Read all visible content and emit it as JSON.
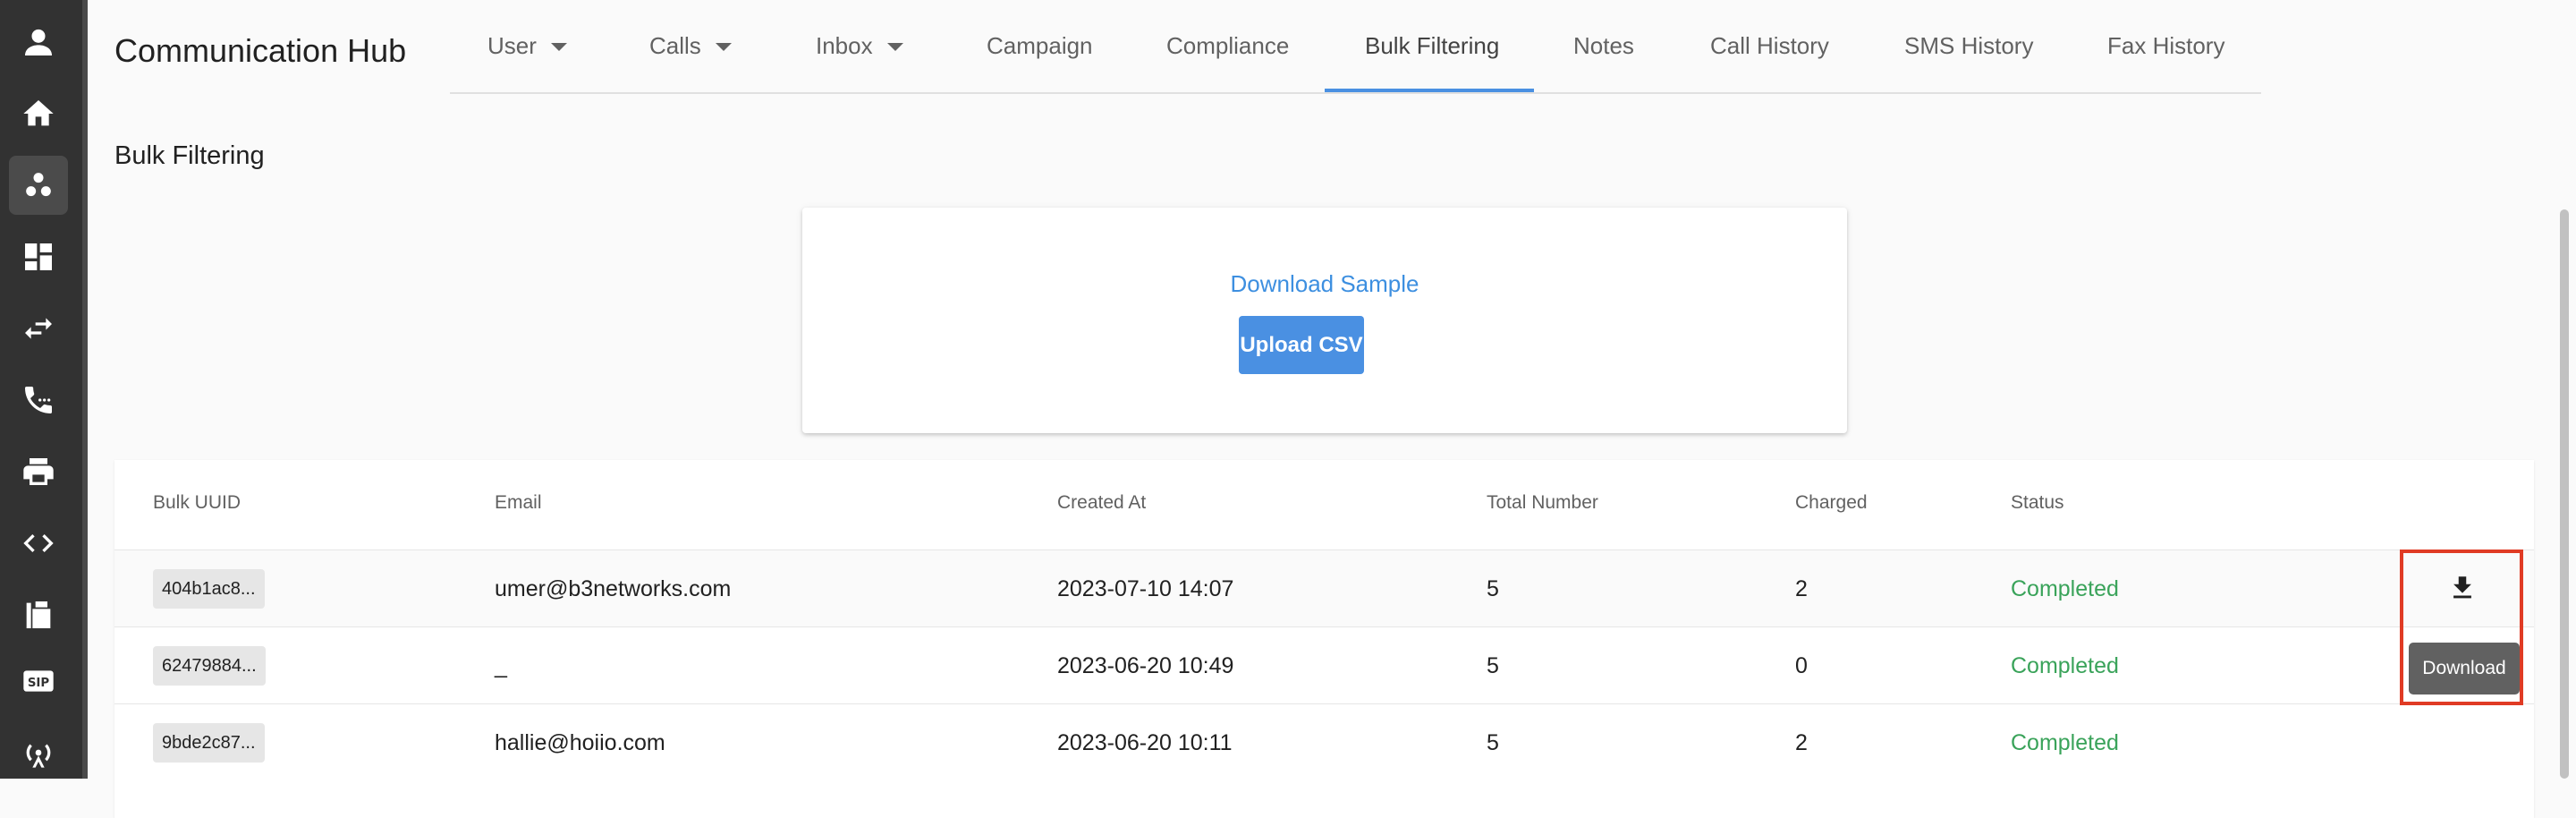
{
  "app": {
    "title": "Communication Hub"
  },
  "sidebar": {
    "items": [
      {
        "icon": "user-avatar-icon"
      },
      {
        "icon": "home-icon"
      },
      {
        "icon": "group-icon",
        "active": true
      },
      {
        "icon": "dashboard-icon"
      },
      {
        "icon": "swap-arrows-icon"
      },
      {
        "icon": "phone-forward-icon"
      },
      {
        "icon": "printer-icon"
      },
      {
        "icon": "code-icon"
      },
      {
        "icon": "fax-icon"
      },
      {
        "icon": "sip-icon",
        "label": "SIP"
      },
      {
        "icon": "antenna-icon"
      }
    ]
  },
  "tabs": [
    {
      "label": "User",
      "dropdown": true
    },
    {
      "label": "Calls",
      "dropdown": true
    },
    {
      "label": "Inbox",
      "dropdown": true
    },
    {
      "label": "Campaign"
    },
    {
      "label": "Compliance"
    },
    {
      "label": "Bulk Filtering",
      "active": true
    },
    {
      "label": "Notes"
    },
    {
      "label": "Call History"
    },
    {
      "label": "SMS History"
    },
    {
      "label": "Fax History"
    }
  ],
  "page": {
    "title": "Bulk Filtering"
  },
  "upload": {
    "download_sample": "Download Sample",
    "upload_button": "Upload CSV"
  },
  "table": {
    "headers": [
      "Bulk UUID",
      "Email",
      "Created At",
      "Total Number",
      "Charged",
      "Status"
    ],
    "rows": [
      {
        "uuid": "404b1ac8...",
        "email": "umer@b3networks.com",
        "created_at": "2023-07-10 14:07",
        "total": "5",
        "charged": "2",
        "status": "Completed"
      },
      {
        "uuid": "62479884...",
        "email": "_",
        "created_at": "2023-06-20 10:49",
        "total": "5",
        "charged": "0",
        "status": "Completed"
      },
      {
        "uuid": "9bde2c87...",
        "email": "hallie@hoiio.com",
        "created_at": "2023-06-20 10:11",
        "total": "5",
        "charged": "2",
        "status": "Completed"
      }
    ],
    "tooltip": "Download"
  },
  "colors": {
    "sidebar_bg": "#323232",
    "accent": "#4a90e2",
    "status_completed": "#3aa35a",
    "highlight_border": "#e03b24"
  }
}
